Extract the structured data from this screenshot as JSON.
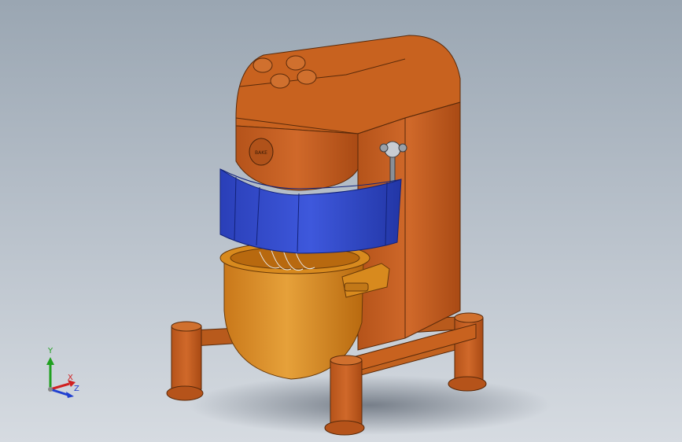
{
  "viewport": {
    "background_top": "#9aa6b2",
    "background_bottom": "#d6dbe1"
  },
  "model": {
    "body_color": "#c8621f",
    "bowl_color": "#d88a1e",
    "guard_color": "#2f47c9",
    "stand_color": "#c8621f",
    "badge_text": "BAKE"
  },
  "triad": {
    "x_label": "X",
    "y_label": "Y",
    "z_label": "Z",
    "x_color": "#d02020",
    "y_color": "#20a020",
    "z_color": "#2040d0"
  }
}
